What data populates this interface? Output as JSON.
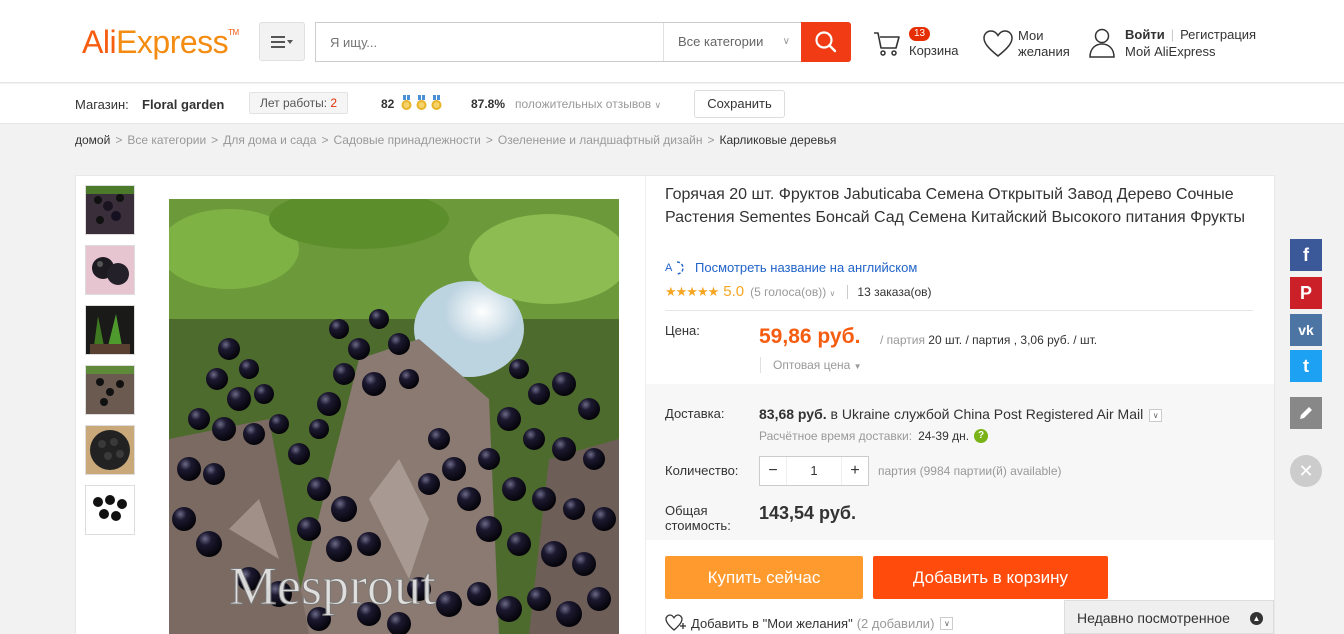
{
  "header": {
    "logo_ali": "Ali",
    "logo_express": "Express",
    "logo_tm": "TM",
    "search_placeholder": "Я ищу...",
    "category_select": "Все категории",
    "cart_count": "13",
    "cart_label": "Корзина",
    "wishlist_label_1": "Мои",
    "wishlist_label_2": "желания",
    "login": "Войти",
    "register": "Регистрация",
    "my_account": "Мой AliExpress"
  },
  "store": {
    "label": "Магазин:",
    "name": "Floral garden",
    "years_label": "Лет работы:",
    "years_value": "2",
    "score": "82",
    "positive_pct": "87.8%",
    "positive_label": "положительных отзывов",
    "save_label": "Сохранить"
  },
  "breadcrumbs": [
    "домой",
    "Все категории",
    "Для дома и сада",
    "Садовые принадлежности",
    "Озеленение и ландшафтный дизайн",
    "Карликовые деревья"
  ],
  "product": {
    "title": "Горячая 20 шт. Фруктов Jabuticaba Семена Открытый Завод Дерево Сочные Растения Sementes Бонсай Сад Семена Китайский Высокого питания Фрукты",
    "translate_label": "Посмотреть название на английском",
    "rating_value": "5.0",
    "votes": "(5 голоса(ов))",
    "orders": "13 заказа(ов)",
    "price_label": "Цена:",
    "price": "59,86 руб.",
    "price_unit_prefix": "/ партия",
    "price_unit_detail": "20 шт. / партия , 3,06 руб. / шт.",
    "wholesale": "Оптовая цена",
    "shipping_label": "Доставка:",
    "shipping_price": "83,68 руб.",
    "shipping_text": "в Ukraine службой China Post Registered Air Mail",
    "eta_label": "Расчётное время доставки:",
    "eta_days": "24-39 дн.",
    "qty_label": "Количество:",
    "qty_value": "1",
    "qty_available": "партия (9984 партии(й) available)",
    "total_label": "Общая стоимость:",
    "total": "143,54 руб.",
    "watermark": "Mesprout"
  },
  "actions": {
    "buy_now": "Купить сейчас",
    "add_cart": "Добавить в корзину",
    "add_wish": "Добавить в \"Мои желания\"",
    "wish_count": "(2 добавили)",
    "recent": "Недавно посмотренное"
  },
  "social": {
    "facebook": "f",
    "pinterest": "P",
    "vk": "vk",
    "twitter": "t"
  },
  "colors": {
    "accent": "#f65d10",
    "buy": "#ff9a2e",
    "cart": "#ff4c0d",
    "search_btn": "#f03b14",
    "facebook": "#3b5998",
    "pinterest": "#cb2027",
    "vk": "#4c75a3",
    "twitter": "#1da1f2"
  }
}
